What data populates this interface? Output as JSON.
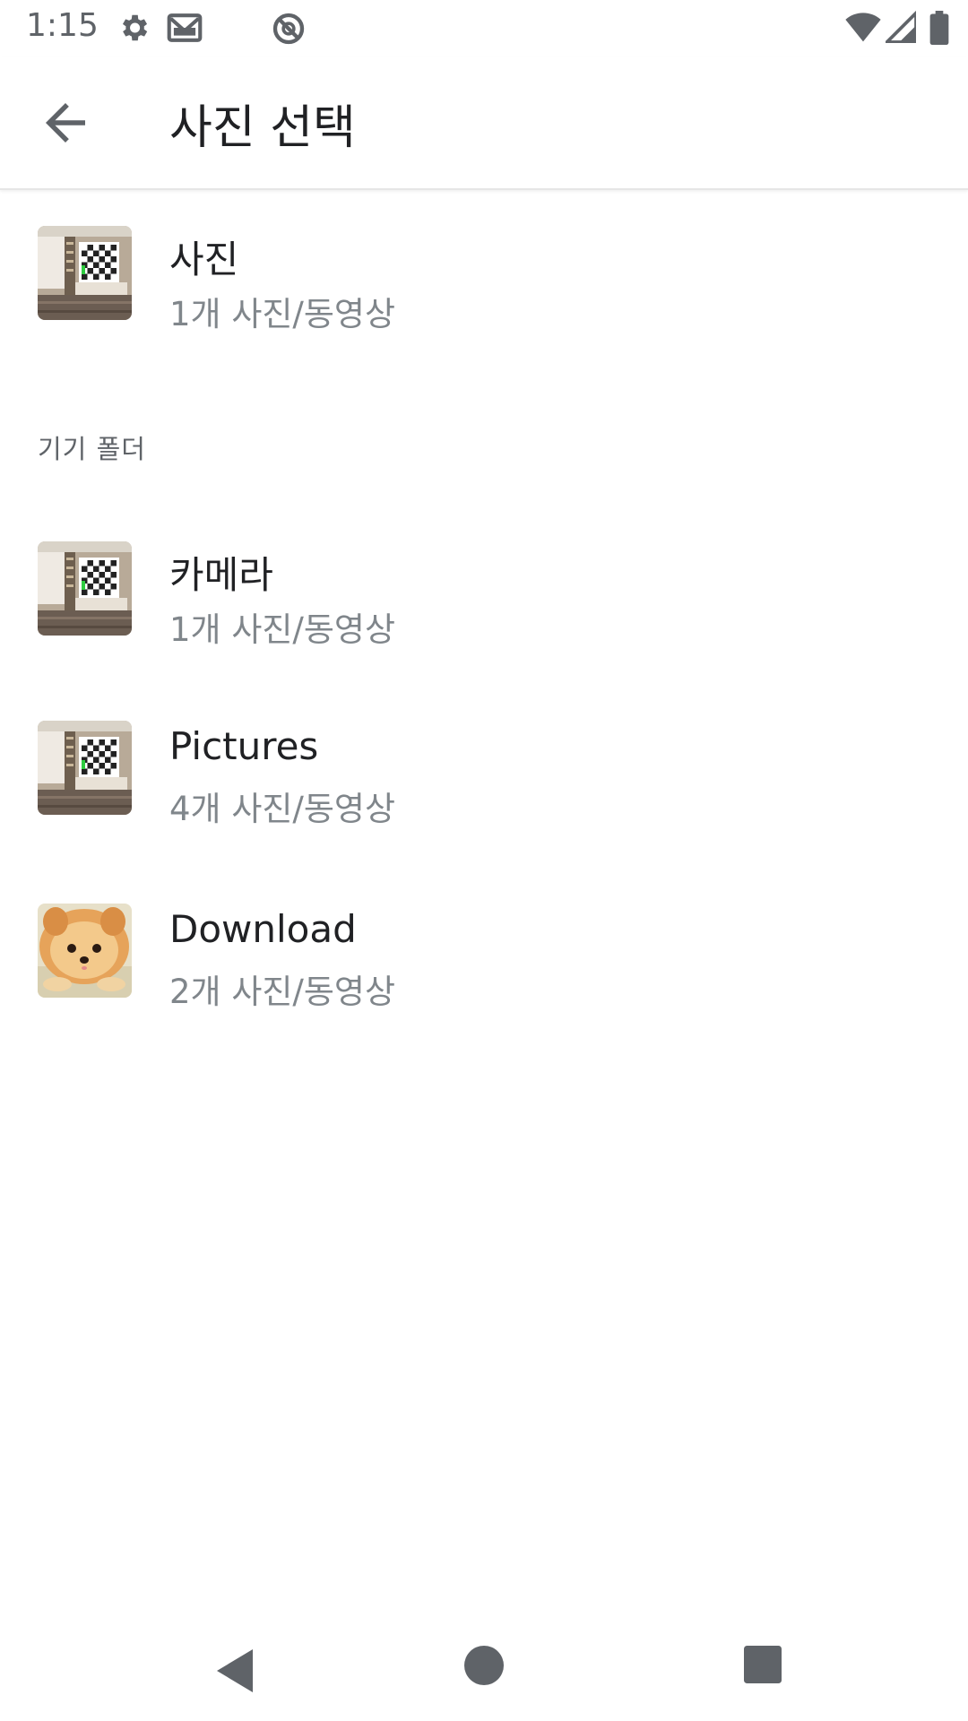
{
  "status_bar": {
    "time": "1:15",
    "icons": [
      "settings-icon",
      "gmail-icon",
      "sync-icon",
      "wifi-icon",
      "signal-icon",
      "battery-icon"
    ]
  },
  "app_bar": {
    "back_icon": "arrow-back-icon",
    "title": "사진 선택"
  },
  "top_album": {
    "name": "사진",
    "count": "1개 사진/동영상",
    "thumb": "living-room-tv-image"
  },
  "section": {
    "header": "기기 폴더"
  },
  "albums": [
    {
      "name": "카메라",
      "count": "1개 사진/동영상",
      "thumb": "living-room-tv-image"
    },
    {
      "name": "Pictures",
      "count": "4개 사진/동영상",
      "thumb": "living-room-tv-image"
    },
    {
      "name": "Download",
      "count": "2개 사진/동영상",
      "thumb": "pomeranian-dog-image"
    }
  ],
  "nav_bar": {
    "icons": [
      "back-triangle-icon",
      "home-circle-icon",
      "recents-square-icon"
    ]
  },
  "colors": {
    "primary_text": "#202124",
    "secondary_text": "#80868b",
    "icon_gray": "#5f6368",
    "divider": "#e6e6e6"
  }
}
